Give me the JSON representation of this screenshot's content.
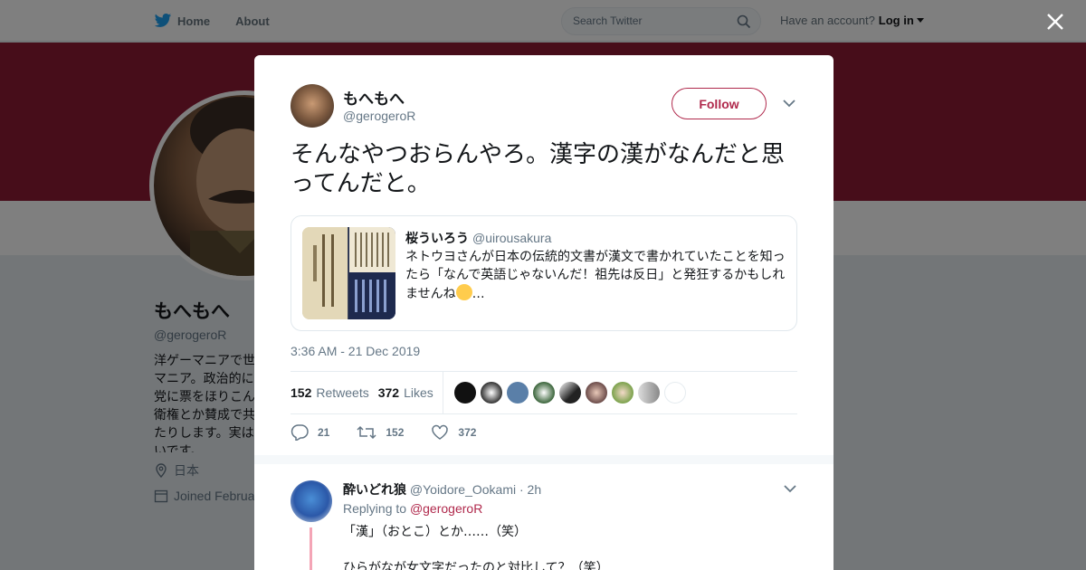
{
  "topbar": {
    "home_label": "Home",
    "about_label": "About",
    "search_placeholder": "Search Twitter",
    "account_prompt": "Have an account?",
    "login_label": "Log in"
  },
  "profile": {
    "name": "もへもへ",
    "handle": "@gerogeroR",
    "bio": "洋ゲーマニアで世\nマニア。政治的に\n党に票をほりこん\n衛権とか賛成で共\nたりします。実は\nいです。",
    "location": "日本",
    "joined": "Joined Februa"
  },
  "tweet": {
    "name": "もへもへ",
    "handle": "@gerogeroR",
    "follow_label": "Follow",
    "text": "そんなやつおらんやろ。漢字の漢がなんだと思ってんだと。",
    "quote": {
      "name": "桜ういろう",
      "handle": "@uirousakura",
      "text": "ネトウヨさんが日本の伝統的文書が漢文で書かれていたことを知ったら「なんで英語じゃないんだ！祖先は反日」と発狂するかもしれませんね",
      "ellipsis": "…"
    },
    "timestamp": "3:36 AM - 21 Dec 2019",
    "retweets_count": "152",
    "retweets_label": "Retweets",
    "likes_count": "372",
    "likes_label": "Likes",
    "reply_count": "21",
    "retweet_action_count": "152",
    "like_action_count": "372"
  },
  "reply": {
    "name": "酔いどれ狼",
    "handle": "@Yoidore_Ookami",
    "time": "· 2h",
    "replying_to_label": "Replying to",
    "replying_to_handle": "@gerogeroR",
    "text_line1": "「漢」（おとこ）とか……（笑）",
    "text_line2": "ひらがなが女文字だったのと対比して？（笑）"
  },
  "colors": {
    "accent": "#b0294c",
    "banner": "#8f1a34",
    "twitter_blue": "#1da1f2"
  }
}
